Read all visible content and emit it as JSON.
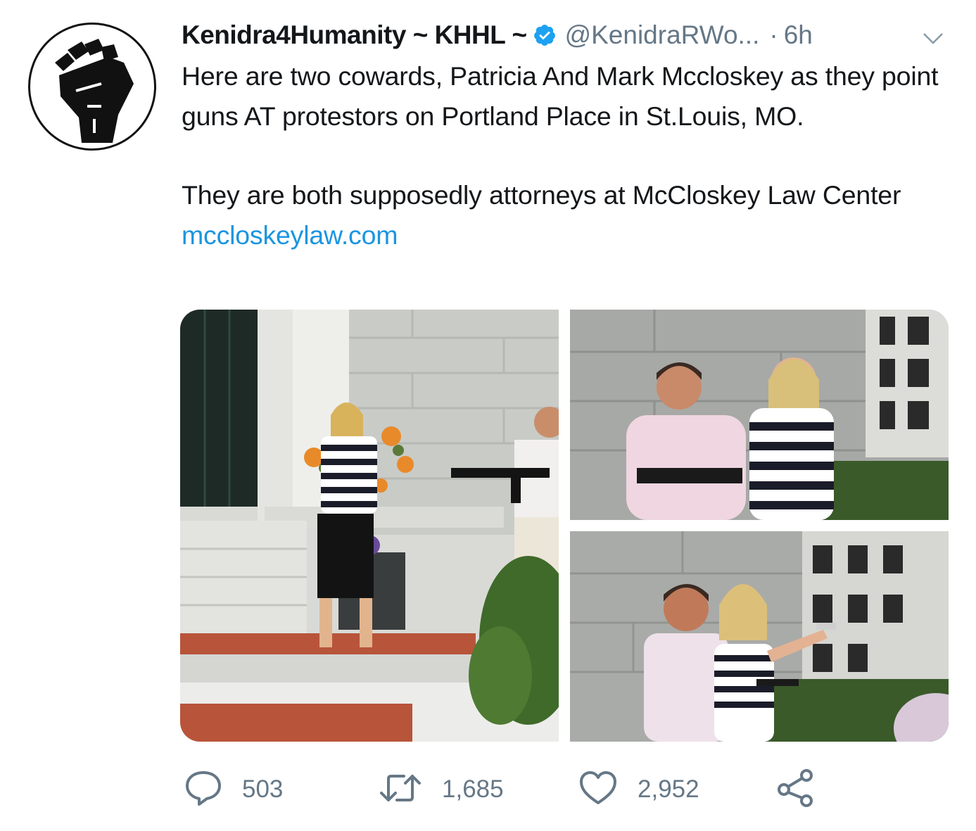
{
  "tweet": {
    "display_name": "Kenidra4Humanity ~ KHHL ~",
    "verified_icon": "verified-badge-icon",
    "handle": "@KenidraRWo...",
    "time": "6h",
    "dot": "·",
    "text_line1": "Here are two cowards, Patricia And Mark Mccloskey as they point guns AT protestors on Portland Place in St.Louis, MO.",
    "text_line2_prefix": "They are both supposedly attorneys at McCloskey Law Center",
    "link_text": "mccloskeylaw.com",
    "avatar_icon": "raised-fist-icon"
  },
  "media": {
    "photos": [
      {
        "name": "photo-woman-on-steps-man-with-rifle"
      },
      {
        "name": "photo-couple-closeup-rifle-pistol"
      },
      {
        "name": "photo-couple-pointing-pistol"
      }
    ]
  },
  "actions": {
    "reply_count": "503",
    "retweet_count": "1,685",
    "like_count": "2,952",
    "icons": [
      "reply-icon",
      "retweet-icon",
      "like-icon",
      "share-icon"
    ]
  },
  "colors": {
    "text": "#14171a",
    "secondary": "#657786",
    "link": "#1b95e0",
    "verified": "#1da1f2"
  }
}
